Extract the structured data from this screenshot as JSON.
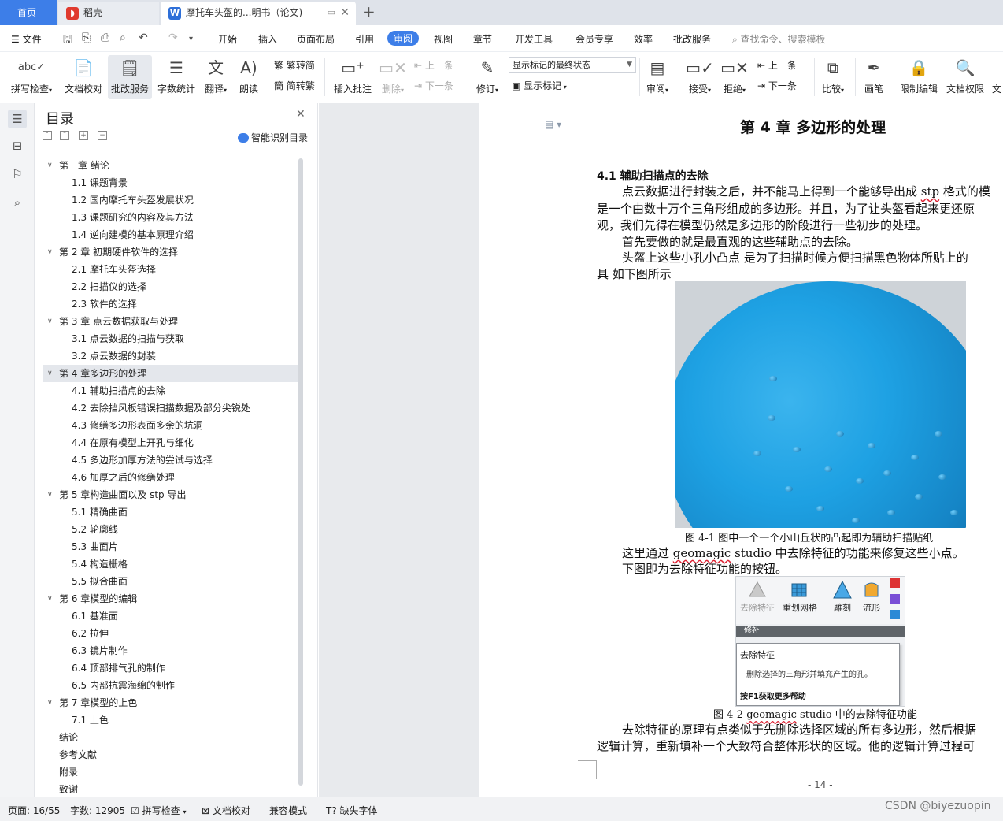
{
  "tabs": {
    "home": "首页",
    "wps": "稻壳",
    "doc": "摩托车头盔的...明书（论文)"
  },
  "menu": {
    "file": "文件",
    "items": [
      "开始",
      "插入",
      "页面布局",
      "引用",
      "审阅",
      "视图",
      "章节",
      "开发工具",
      "会员专享",
      "效率",
      "批改服务"
    ],
    "active": "审阅",
    "search": "查找命令、搜索模板"
  },
  "ribbon": {
    "spell": "拼写检查",
    "proof": "文档校对",
    "review_service": "批改服务",
    "word_count": "字数统计",
    "translate": "翻译",
    "read_aloud": "朗读",
    "to_trad": "繁转简",
    "to_simp": "简转繁",
    "insert_comment": "插入批注",
    "delete": "删除",
    "prev": "上一条",
    "next": "下一条",
    "track": "修订",
    "markup_state": "显示标记的最终状态",
    "show_markup": "显示标记",
    "review": "审阅",
    "accept": "接受",
    "reject": "拒绝",
    "prev2": "上一条",
    "next2": "下一条",
    "compare": "比较",
    "ink": "画笔",
    "restrict": "限制编辑",
    "permission": "文档权限",
    "cut": "文"
  },
  "toc": {
    "title": "目录",
    "smart": "智能识别目录",
    "items": [
      {
        "level": 1,
        "text": "第一章  绪论"
      },
      {
        "level": 2,
        "text": "1.1 课题背景"
      },
      {
        "level": 2,
        "text": "1.2 国内摩托车头盔发展状况"
      },
      {
        "level": 2,
        "text": "1.3 课题研究的内容及其方法"
      },
      {
        "level": 2,
        "text": "1.4 逆向建模的基本原理介绍"
      },
      {
        "level": 1,
        "text": "第 2 章  初期硬件软件的选择"
      },
      {
        "level": 2,
        "text": "2.1 摩托车头盔选择"
      },
      {
        "level": 2,
        "text": "2.2 扫描仪的选择"
      },
      {
        "level": 2,
        "text": "2.3  软件的选择"
      },
      {
        "level": 1,
        "text": "第 3 章    点云数据获取与处理"
      },
      {
        "level": 2,
        "text": "3.1  点云数据的扫描与获取"
      },
      {
        "level": 2,
        "text": "3.2  点云数据的封装"
      },
      {
        "level": 1,
        "text": "第 4 章多边形的处理",
        "selected": true
      },
      {
        "level": 2,
        "text": "4.1  辅助扫描点的去除"
      },
      {
        "level": 2,
        "text": "4.2  去除挡风板错误扫描数据及部分尖锐处"
      },
      {
        "level": 2,
        "text": "4.3  修缮多边形表面多余的坑洞"
      },
      {
        "level": 2,
        "text": "4.4  在原有模型上开孔与细化"
      },
      {
        "level": 2,
        "text": "4.5  多边形加厚方法的尝试与选择"
      },
      {
        "level": 2,
        "text": "4.6  加厚之后的修缮处理"
      },
      {
        "level": 1,
        "text": "第 5 章构造曲面以及 stp 导出"
      },
      {
        "level": 2,
        "text": "5.1  精确曲面"
      },
      {
        "level": 2,
        "text": "5.2  轮廓线"
      },
      {
        "level": 2,
        "text": "5.3  曲面片"
      },
      {
        "level": 2,
        "text": "5.4  构造栅格"
      },
      {
        "level": 2,
        "text": "5.5  拟合曲面"
      },
      {
        "level": 1,
        "text": "第 6 章模型的编辑"
      },
      {
        "level": 2,
        "text": "6.1  基准面"
      },
      {
        "level": 2,
        "text": "6.2  拉伸"
      },
      {
        "level": 2,
        "text": "6.3  镜片制作"
      },
      {
        "level": 2,
        "text": "6.4  顶部排气孔的制作"
      },
      {
        "level": 2,
        "text": "6.5  内部抗震海绵的制作"
      },
      {
        "level": 1,
        "text": "第 7 章模型的上色"
      },
      {
        "level": 2,
        "text": "7.1  上色"
      },
      {
        "level": 0,
        "text": "结论"
      },
      {
        "level": 0,
        "text": "参考文献"
      },
      {
        "level": 0,
        "text": "附录"
      },
      {
        "level": 0,
        "text": "致谢"
      }
    ]
  },
  "doc": {
    "chapter": "第 4 章  多边形的处理",
    "section": "4.1  辅助扫描点的去除",
    "p1a": "点云数据进行封装之后，并不能马上得到一个能够导出成",
    "p1b": "stp",
    "p1c": "格式的模",
    "p2": "是一个由数十万个三角形组成的多边形。并且，为了让头盔看起来更还原",
    "p3": "观，我们先得在模型仍然是多边形的阶段进行一些初步的处理。",
    "p4": "首先要做的就是最直观的这些辅助点的去除。",
    "p5": "头盔上这些小孔小凸点  是为了扫描时候方便扫描黑色物体所贴上的",
    "p6": "具  如下图所示",
    "cap1": "图 4-1  图中一个一个小山丘状的凸起即为辅助扫描贴纸",
    "p7a": "这里通过",
    "p7b": "geomagic",
    "p7c": "studio 中去除特征的功能来修复这些小点。",
    "p8": "下图即为去除特征功能的按钮。",
    "cap2a": "图 4-2",
    "cap2b": "geomagic",
    "cap2c": "studio 中的去除特征功能",
    "p9": "去除特征的原理有点类似于先删除选择区域的所有多边形，然后根据",
    "p10": "逻辑计算，重新填补一个大致符合整体形状的区域。他的逻辑计算过程可",
    "page_no": "- 14 -"
  },
  "fig2": {
    "b1": "去除特征",
    "b2": "重划网格",
    "b3": "雕刻",
    "b4": "流形",
    "bar": "修补",
    "tip_title": "去除特征",
    "tip_desc": "删除选择的三角形并填充产生的孔。",
    "tip_help": "按F1获取更多帮助"
  },
  "status": {
    "page": "页面: 16/55",
    "words": "字数: 12905",
    "spell": "拼写检查",
    "proof": "文档校对",
    "compat": "兼容模式",
    "missing_font": "缺失字体"
  },
  "watermark": "CSDN @biyezuopin",
  "colors": {
    "accent": "#3d7ee8",
    "helmet": "#1ea1e3"
  }
}
